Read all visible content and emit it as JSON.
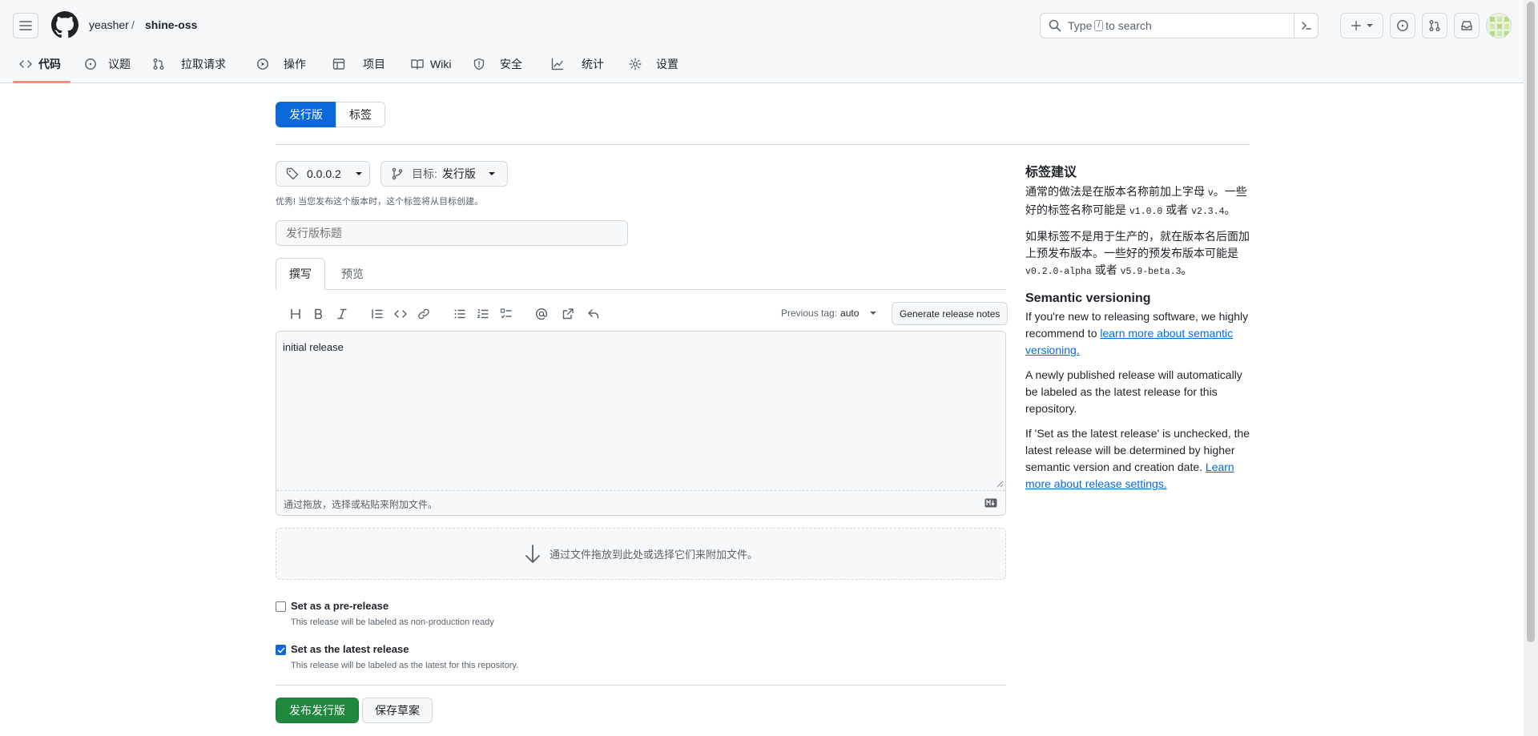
{
  "header": {
    "owner": "yeasher",
    "separator": "/",
    "repo": "shine-oss",
    "search": {
      "prefix": "Type",
      "key": "/",
      "suffix": "to search"
    }
  },
  "nav": {
    "tabs": [
      {
        "label": "代码",
        "icon": "code-icon",
        "active": true
      },
      {
        "label": "议题",
        "icon": "issue-opened-icon"
      },
      {
        "label": "拉取请求",
        "icon": "git-pull-request-icon"
      },
      {
        "label": "操作",
        "icon": "play-icon"
      },
      {
        "label": "项目",
        "icon": "table-icon"
      },
      {
        "label": "Wiki",
        "icon": "book-icon"
      },
      {
        "label": "安全",
        "icon": "shield-icon"
      },
      {
        "label": "统计",
        "icon": "graph-icon"
      },
      {
        "label": "设置",
        "icon": "gear-icon"
      }
    ]
  },
  "segmented": {
    "releases": "发行版",
    "tags": "标签"
  },
  "form": {
    "tag_label": "0.0.0.2",
    "target_prefix": "目标:",
    "target_value": "发行版",
    "hint": "优秀! 当您发布这个版本时，这个标签将从目标创建。",
    "title_placeholder": "发行版标题",
    "tabs": {
      "write": "撰写",
      "preview": "预览"
    },
    "previous_tag_label": "Previous tag:",
    "previous_tag_value": "auto",
    "generate_notes": "Generate release notes",
    "body": "initial release",
    "attach_hint": "通过拖放，选择或粘贴来附加文件。",
    "dropzone": "通过文件拖放到此处或选择它们来附加文件。",
    "prerelease": {
      "label": "Set as a pre-release",
      "desc": "This release will be labeled as non-production ready",
      "checked": false
    },
    "latest": {
      "label": "Set as the latest release",
      "desc": "This release will be labeled as the latest for this repository.",
      "checked": true
    },
    "publish": "发布发行版",
    "save_draft": "保存草案"
  },
  "sidebar": {
    "tag_title": "标签建议",
    "p1_a": "通常的做法是在版本名称前加上字母",
    "p1_code1": "v",
    "p1_b": "。一些好的标签名称可能是",
    "p1_code2": "v1.0.0",
    "p1_c": "或者",
    "p1_code3": "v2.3.4",
    "p1_d": "。",
    "p2_a": "如果标签不是用于生产的，就在版本名后面加上预发布版本。一些好的预发布版本可能是",
    "p2_code1": "v0.2.0-alpha",
    "p2_b": "或者",
    "p2_code2": "v5.9-beta.3",
    "p2_c": "。",
    "semver_title": "Semantic versioning",
    "p3_a": "If you're new to releasing software, we highly recommend to",
    "p3_link": "learn more about semantic versioning.",
    "p4": "A newly published release will automatically be labeled as the latest release for this repository.",
    "p5_a": "If 'Set as the latest release' is unchecked, the latest release will be determined by higher semantic version and creation date.",
    "p5_link": "Learn more about release settings."
  },
  "colors": {
    "accent": "#0969da",
    "publish_green": "#1f883d",
    "tab_underline": "#fd8c73"
  }
}
